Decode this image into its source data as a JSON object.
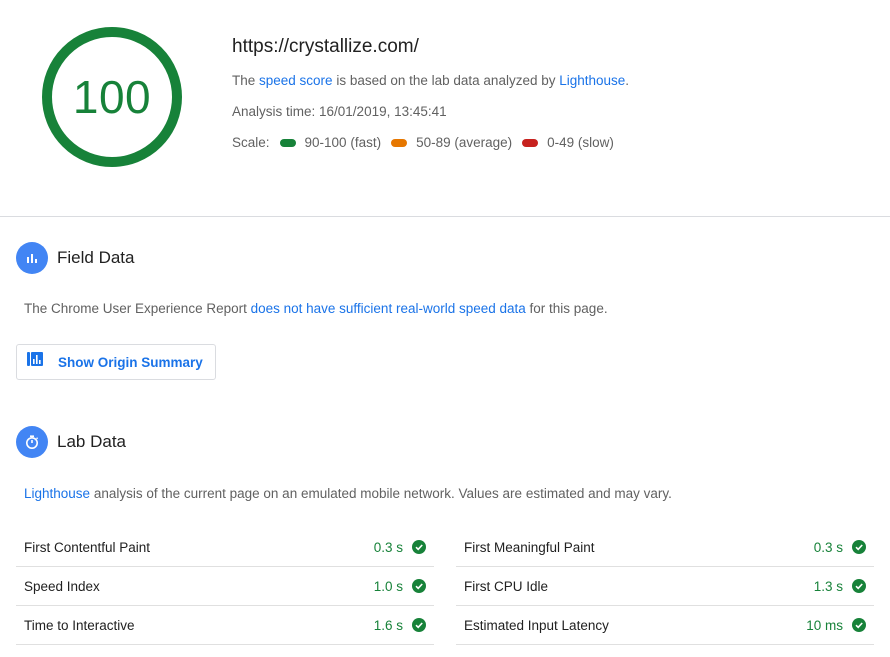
{
  "score": {
    "value": "100",
    "color": "#178239"
  },
  "header": {
    "url": "https://crystallize.com/",
    "desc_prefix": "The ",
    "desc_link1": "speed score",
    "desc_middle": " is based on the lab data analyzed by ",
    "desc_link2": "Lighthouse",
    "desc_suffix": ".",
    "analysis_time": "Analysis time: 16/01/2019, 13:45:41",
    "scale_label": "Scale:",
    "scale": [
      {
        "label": "90-100 (fast)",
        "color": "#178239"
      },
      {
        "label": "50-89 (average)",
        "color": "#e67700"
      },
      {
        "label": "0-49 (slow)",
        "color": "#c7221f"
      }
    ]
  },
  "field_data": {
    "title": "Field Data",
    "icon": "bar-chart-icon",
    "text_prefix": "The Chrome User Experience Report ",
    "text_link": "does not have sufficient real-world speed data",
    "text_suffix": " for this page.",
    "button_label": "Show Origin Summary",
    "button_icon": "origin-summary-icon"
  },
  "lab_data": {
    "title": "Lab Data",
    "icon": "stopwatch-icon",
    "text_link": "Lighthouse",
    "text_suffix": " analysis of the current page on an emulated mobile network. Values are estimated and may vary.",
    "left": [
      {
        "name": "First Contentful Paint",
        "value": "0.3 s"
      },
      {
        "name": "Speed Index",
        "value": "1.0 s"
      },
      {
        "name": "Time to Interactive",
        "value": "1.6 s"
      }
    ],
    "right": [
      {
        "name": "First Meaningful Paint",
        "value": "0.3 s"
      },
      {
        "name": "First CPU Idle",
        "value": "1.3 s"
      },
      {
        "name": "Estimated Input Latency",
        "value": "10 ms"
      }
    ],
    "status_color": "#178239"
  }
}
